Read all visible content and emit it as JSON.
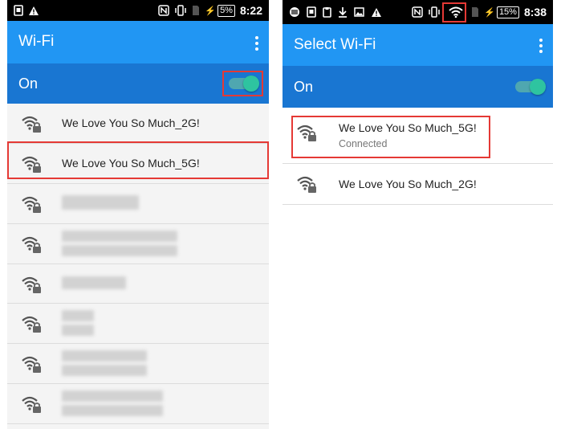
{
  "left": {
    "status_bar": {
      "icons_left": [
        "screenshot-icon",
        "warning-icon"
      ],
      "icons_right": [
        "nfc-icon",
        "vibrate-icon",
        "sim-icon",
        "charging-icon"
      ],
      "battery": "5%",
      "time": "8:22"
    },
    "app_bar": {
      "title": "Wi-Fi",
      "menu_icon": "overflow-menu-icon"
    },
    "toggle": {
      "label": "On",
      "enabled": true
    },
    "networks": [
      {
        "ssid": "We Love You So Much_2G!"
      },
      {
        "ssid": "We Love You So Much_5G!"
      }
    ],
    "hidden_network_rows": 6
  },
  "right": {
    "status_bar": {
      "icons_left": [
        "notification-icon",
        "screenshot-icon",
        "clipboard-icon",
        "download-icon",
        "image-icon",
        "warning-icon"
      ],
      "icons_right": [
        "nfc-icon",
        "vibrate-icon",
        "wifi-icon",
        "sim-icon",
        "charging-icon"
      ],
      "battery": "15%",
      "time": "8:38"
    },
    "app_bar": {
      "title": "Select Wi-Fi",
      "menu_icon": "overflow-menu-icon"
    },
    "toggle": {
      "label": "On",
      "enabled": true
    },
    "networks": [
      {
        "ssid": "We Love You So Much_5G!",
        "status": "Connected"
      },
      {
        "ssid": "We Love You So Much_2G!"
      }
    ]
  },
  "colors": {
    "app_bar": "#2196f3",
    "toggle_bar": "#1976d2",
    "switch_thumb": "#2ec4a0",
    "highlight": "#e53935",
    "list_bg_left": "#f4f4f4"
  }
}
